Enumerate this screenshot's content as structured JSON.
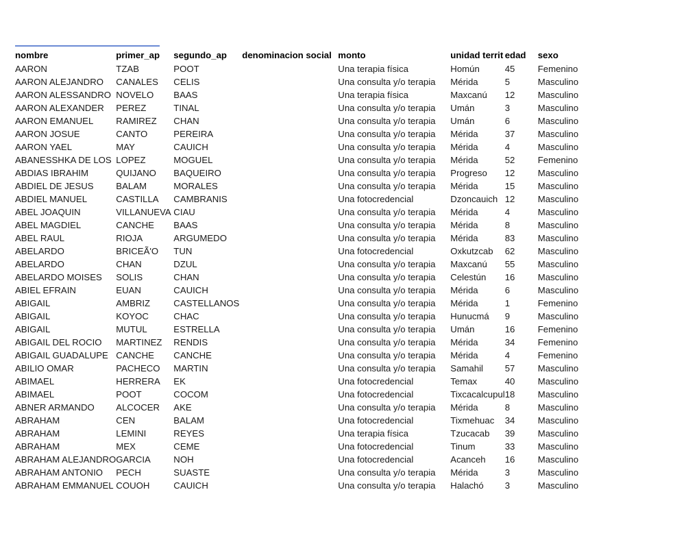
{
  "sheet": {
    "accent_color": "#6a8ad4",
    "background_color": "#ffffff",
    "text_color": "#1a1a1a"
  },
  "table": {
    "columns": [
      {
        "key": "nombre",
        "label": "nombre"
      },
      {
        "key": "primer",
        "label": "primer_ap"
      },
      {
        "key": "segundo",
        "label": "segundo_ap"
      },
      {
        "key": "denom",
        "label": "denominacion social"
      },
      {
        "key": "monto",
        "label": "monto"
      },
      {
        "key": "unidad",
        "label": "unidad territ"
      },
      {
        "key": "edad",
        "label": "edad"
      },
      {
        "key": "sexo",
        "label": "sexo"
      }
    ],
    "row_count": 31,
    "rows": [
      {
        "nombre": "AARON",
        "primer": "TZAB",
        "segundo": "POOT",
        "denom": "",
        "monto": "Una terapia física",
        "unidad": "Homún",
        "edad": "45",
        "sexo": "Femenino"
      },
      {
        "nombre": "AARON ALEJANDRO",
        "primer": "CANALES",
        "segundo": "CELIS",
        "denom": "",
        "monto": "Una consulta y/o terapia",
        "unidad": "Mérida",
        "edad": "5",
        "sexo": "Masculino"
      },
      {
        "nombre": "AARON ALESSANDRO",
        "primer": "NOVELO",
        "segundo": "BAAS",
        "denom": "",
        "monto": "Una terapia física",
        "unidad": "Maxcanú",
        "edad": "12",
        "sexo": "Masculino"
      },
      {
        "nombre": "AARON ALEXANDER",
        "primer": "PEREZ",
        "segundo": "TINAL",
        "denom": "",
        "monto": "Una consulta y/o terapia",
        "unidad": "Umán",
        "edad": "3",
        "sexo": "Masculino"
      },
      {
        "nombre": "AARON EMANUEL",
        "primer": "RAMIREZ",
        "segundo": "CHAN",
        "denom": "",
        "monto": "Una consulta y/o terapia",
        "unidad": "Umán",
        "edad": "6",
        "sexo": "Masculino"
      },
      {
        "nombre": "AARON JOSUE",
        "primer": "CANTO",
        "segundo": "PEREIRA",
        "denom": "",
        "monto": "Una consulta y/o terapia",
        "unidad": "Mérida",
        "edad": "37",
        "sexo": "Masculino"
      },
      {
        "nombre": "AARON YAEL",
        "primer": "MAY",
        "segundo": "CAUICH",
        "denom": "",
        "monto": "Una consulta y/o terapia",
        "unidad": "Mérida",
        "edad": "4",
        "sexo": "Masculino"
      },
      {
        "nombre": "ABANESSHKA DE LOS",
        "primer": "LOPEZ",
        "segundo": "MOGUEL",
        "denom": "",
        "monto": "Una consulta y/o terapia",
        "unidad": "Mérida",
        "edad": "52",
        "sexo": "Femenino"
      },
      {
        "nombre": "ABDIAS IBRAHIM",
        "primer": "QUIJANO",
        "segundo": "BAQUEIRO",
        "denom": "",
        "monto": "Una consulta y/o terapia",
        "unidad": "Progreso",
        "edad": "12",
        "sexo": "Masculino"
      },
      {
        "nombre": "ABDIEL DE JESUS",
        "primer": "BALAM",
        "segundo": "MORALES",
        "denom": "",
        "monto": "Una consulta y/o terapia",
        "unidad": "Mérida",
        "edad": "15",
        "sexo": "Masculino"
      },
      {
        "nombre": "ABDIEL MANUEL",
        "primer": "CASTILLA",
        "segundo": "CAMBRANIS",
        "denom": "",
        "monto": "Una fotocredencial",
        "unidad": "Dzoncauich",
        "edad": "12",
        "sexo": "Masculino"
      },
      {
        "nombre": "ABEL JOAQUIN",
        "primer": "VILLANUEVA",
        "segundo": "CIAU",
        "denom": "",
        "monto": "Una consulta y/o terapia",
        "unidad": "Mérida",
        "edad": "4",
        "sexo": "Masculino"
      },
      {
        "nombre": "ABEL MAGDIEL",
        "primer": "CANCHE",
        "segundo": "BAAS",
        "denom": "",
        "monto": "Una consulta y/o terapia",
        "unidad": "Mérida",
        "edad": "8",
        "sexo": "Masculino"
      },
      {
        "nombre": "ABEL RAUL",
        "primer": "RIOJA",
        "segundo": "ARGUMEDO",
        "denom": "",
        "monto": "Una consulta y/o terapia",
        "unidad": "Mérida",
        "edad": "83",
        "sexo": "Masculino"
      },
      {
        "nombre": "ABELARDO",
        "primer": "BRICEÃ'O",
        "segundo": "TUN",
        "denom": "",
        "monto": "Una fotocredencial",
        "unidad": "Oxkutzcab",
        "edad": "62",
        "sexo": "Masculino"
      },
      {
        "nombre": "ABELARDO",
        "primer": "CHAN",
        "segundo": "DZUL",
        "denom": "",
        "monto": "Una consulta y/o terapia",
        "unidad": "Maxcanú",
        "edad": "55",
        "sexo": "Masculino"
      },
      {
        "nombre": "ABELARDO MOISES",
        "primer": "SOLIS",
        "segundo": "CHAN",
        "denom": "",
        "monto": "Una consulta y/o terapia",
        "unidad": "Celestún",
        "edad": "16",
        "sexo": "Masculino"
      },
      {
        "nombre": "ABIEL EFRAIN",
        "primer": "EUAN",
        "segundo": "CAUICH",
        "denom": "",
        "monto": "Una consulta y/o terapia",
        "unidad": "Mérida",
        "edad": "6",
        "sexo": "Masculino"
      },
      {
        "nombre": "ABIGAIL",
        "primer": "AMBRIZ",
        "segundo": "CASTELLANOS",
        "denom": "",
        "monto": "Una consulta y/o terapia",
        "unidad": "Mérida",
        "edad": "1",
        "sexo": "Femenino"
      },
      {
        "nombre": "ABIGAIL",
        "primer": "KOYOC",
        "segundo": "CHAC",
        "denom": "",
        "monto": "Una consulta y/o terapia",
        "unidad": "Hunucmá",
        "edad": "9",
        "sexo": "Masculino"
      },
      {
        "nombre": "ABIGAIL",
        "primer": "MUTUL",
        "segundo": "ESTRELLA",
        "denom": "",
        "monto": "Una consulta y/o terapia",
        "unidad": "Umán",
        "edad": "16",
        "sexo": "Femenino"
      },
      {
        "nombre": "ABIGAIL DEL ROCIO",
        "primer": "MARTINEZ",
        "segundo": "RENDIS",
        "denom": "",
        "monto": "Una consulta y/o terapia",
        "unidad": "Mérida",
        "edad": "34",
        "sexo": "Femenino"
      },
      {
        "nombre": "ABIGAIL GUADALUPE",
        "primer": "CANCHE",
        "segundo": "CANCHE",
        "denom": "",
        "monto": "Una consulta y/o terapia",
        "unidad": "Mérida",
        "edad": "4",
        "sexo": "Femenino"
      },
      {
        "nombre": "ABILIO OMAR",
        "primer": "PACHECO",
        "segundo": "MARTIN",
        "denom": "",
        "monto": "Una consulta y/o terapia",
        "unidad": "Samahil",
        "edad": "57",
        "sexo": "Masculino"
      },
      {
        "nombre": "ABIMAEL",
        "primer": "HERRERA",
        "segundo": "EK",
        "denom": "",
        "monto": "Una fotocredencial",
        "unidad": "Temax",
        "edad": "40",
        "sexo": "Masculino"
      },
      {
        "nombre": "ABIMAEL",
        "primer": "POOT",
        "segundo": "COCOM",
        "denom": "",
        "monto": "Una fotocredencial",
        "unidad": "Tixcacalcupul",
        "edad": "18",
        "sexo": "Masculino"
      },
      {
        "nombre": "ABNER ARMANDO",
        "primer": "ALCOCER",
        "segundo": "AKE",
        "denom": "",
        "monto": "Una consulta y/o terapia",
        "unidad": "Mérida",
        "edad": "8",
        "sexo": "Masculino"
      },
      {
        "nombre": "ABRAHAM",
        "primer": "CEN",
        "segundo": "BALAM",
        "denom": "",
        "monto": "Una fotocredencial",
        "unidad": "Tixmehuac",
        "edad": "34",
        "sexo": "Masculino"
      },
      {
        "nombre": "ABRAHAM",
        "primer": "LEMINI",
        "segundo": "REYES",
        "denom": "",
        "monto": "Una terapia física",
        "unidad": "Tzucacab",
        "edad": "39",
        "sexo": "Masculino"
      },
      {
        "nombre": "ABRAHAM",
        "primer": "MEX",
        "segundo": "CEME",
        "denom": "",
        "monto": "Una fotocredencial",
        "unidad": "Tinum",
        "edad": "33",
        "sexo": "Masculino"
      },
      {
        "nombre": "ABRAHAM ALEJANDRO",
        "primer": "GARCIA",
        "segundo": "NOH",
        "denom": "",
        "monto": "Una fotocredencial",
        "unidad": "Acanceh",
        "edad": "16",
        "sexo": "Masculino"
      },
      {
        "nombre": "ABRAHAM ANTONIO",
        "primer": "PECH",
        "segundo": "SUASTE",
        "denom": "",
        "monto": "Una consulta y/o terapia",
        "unidad": "Mérida",
        "edad": "3",
        "sexo": "Masculino"
      },
      {
        "nombre": "ABRAHAM EMMANUEL",
        "primer": "COUOH",
        "segundo": "CAUICH",
        "denom": "",
        "monto": "Una consulta y/o terapia",
        "unidad": "Halachó",
        "edad": "3",
        "sexo": "Masculino"
      }
    ]
  }
}
